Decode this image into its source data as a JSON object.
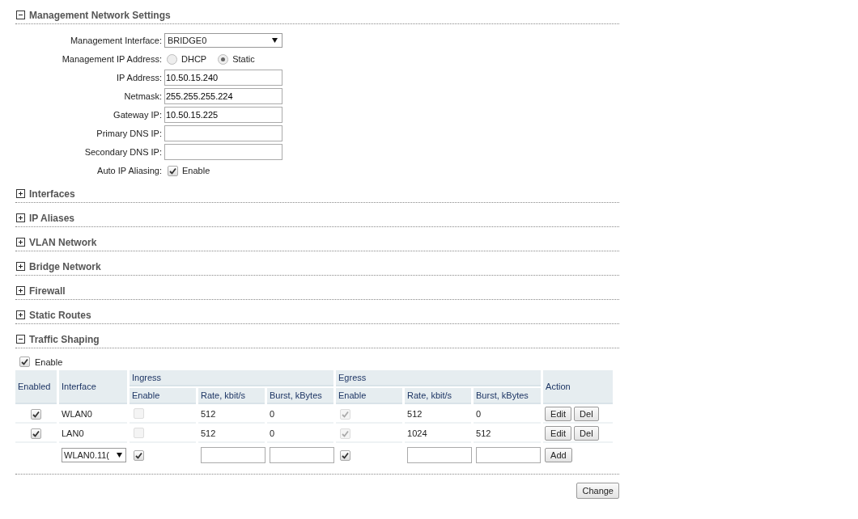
{
  "management": {
    "title": "Management Network Settings",
    "expanded": true,
    "fields": [
      {
        "kind": "select",
        "label": "Management Interface:",
        "value": "BRIDGE0"
      },
      {
        "kind": "radio",
        "label": "Management IP Address:",
        "options": [
          {
            "label": "DHCP",
            "selected": false
          },
          {
            "label": "Static",
            "selected": true
          }
        ]
      },
      {
        "kind": "text",
        "label": "IP Address:",
        "value": "10.50.15.240"
      },
      {
        "kind": "text",
        "label": "Netmask:",
        "value": "255.255.255.224"
      },
      {
        "kind": "text",
        "label": "Gateway IP:",
        "value": "10.50.15.225"
      },
      {
        "kind": "text",
        "label": "Primary DNS IP:"
      },
      {
        "kind": "text",
        "label": "Secondary DNS IP:"
      },
      {
        "kind": "checkbox",
        "label": "Auto IP Aliasing:",
        "option": "Enable",
        "checked": true
      }
    ]
  },
  "sections": [
    {
      "title": "Interfaces",
      "expanded": false
    },
    {
      "title": "IP Aliases",
      "expanded": false
    },
    {
      "title": "VLAN Network",
      "expanded": false
    },
    {
      "title": "Bridge Network",
      "expanded": false
    },
    {
      "title": "Firewall",
      "expanded": false
    },
    {
      "title": "Static Routes",
      "expanded": false
    }
  ],
  "traffic_shaping": {
    "title": "Traffic Shaping",
    "expanded": true,
    "enable": {
      "label": "Enable",
      "checked": true
    },
    "columns": {
      "enabled": "Enabled",
      "interface": "Interface",
      "ingress": "Ingress",
      "egress": "Egress",
      "enable": "Enable",
      "rate": "Rate, kbit/s",
      "burst": "Burst, kBytes",
      "action": "Action"
    },
    "egress_columns": {
      "enable": "Enable",
      "rate": "Rate, kbit/s",
      "burst": "Burst, kBytes"
    },
    "rows": [
      {
        "enabled": true,
        "interface": "WLAN0",
        "ingress_enable": false,
        "ingress_rate": "512",
        "ingress_burst": "0",
        "egress_enable": true,
        "egress_rate": "512",
        "egress_burst": "0",
        "edit": "Edit",
        "delete": "Del"
      },
      {
        "enabled": true,
        "interface": "LAN0",
        "ingress_enable": false,
        "ingress_rate": "512",
        "ingress_burst": "0",
        "egress_enable": true,
        "egress_rate": "1024",
        "egress_burst": "512",
        "edit": "Edit",
        "delete": "Del"
      }
    ],
    "new_row": {
      "interface": "WLAN0.11(",
      "ingress_enable": true,
      "egress_enable": true,
      "add": "Add"
    }
  },
  "change_button": "Change"
}
